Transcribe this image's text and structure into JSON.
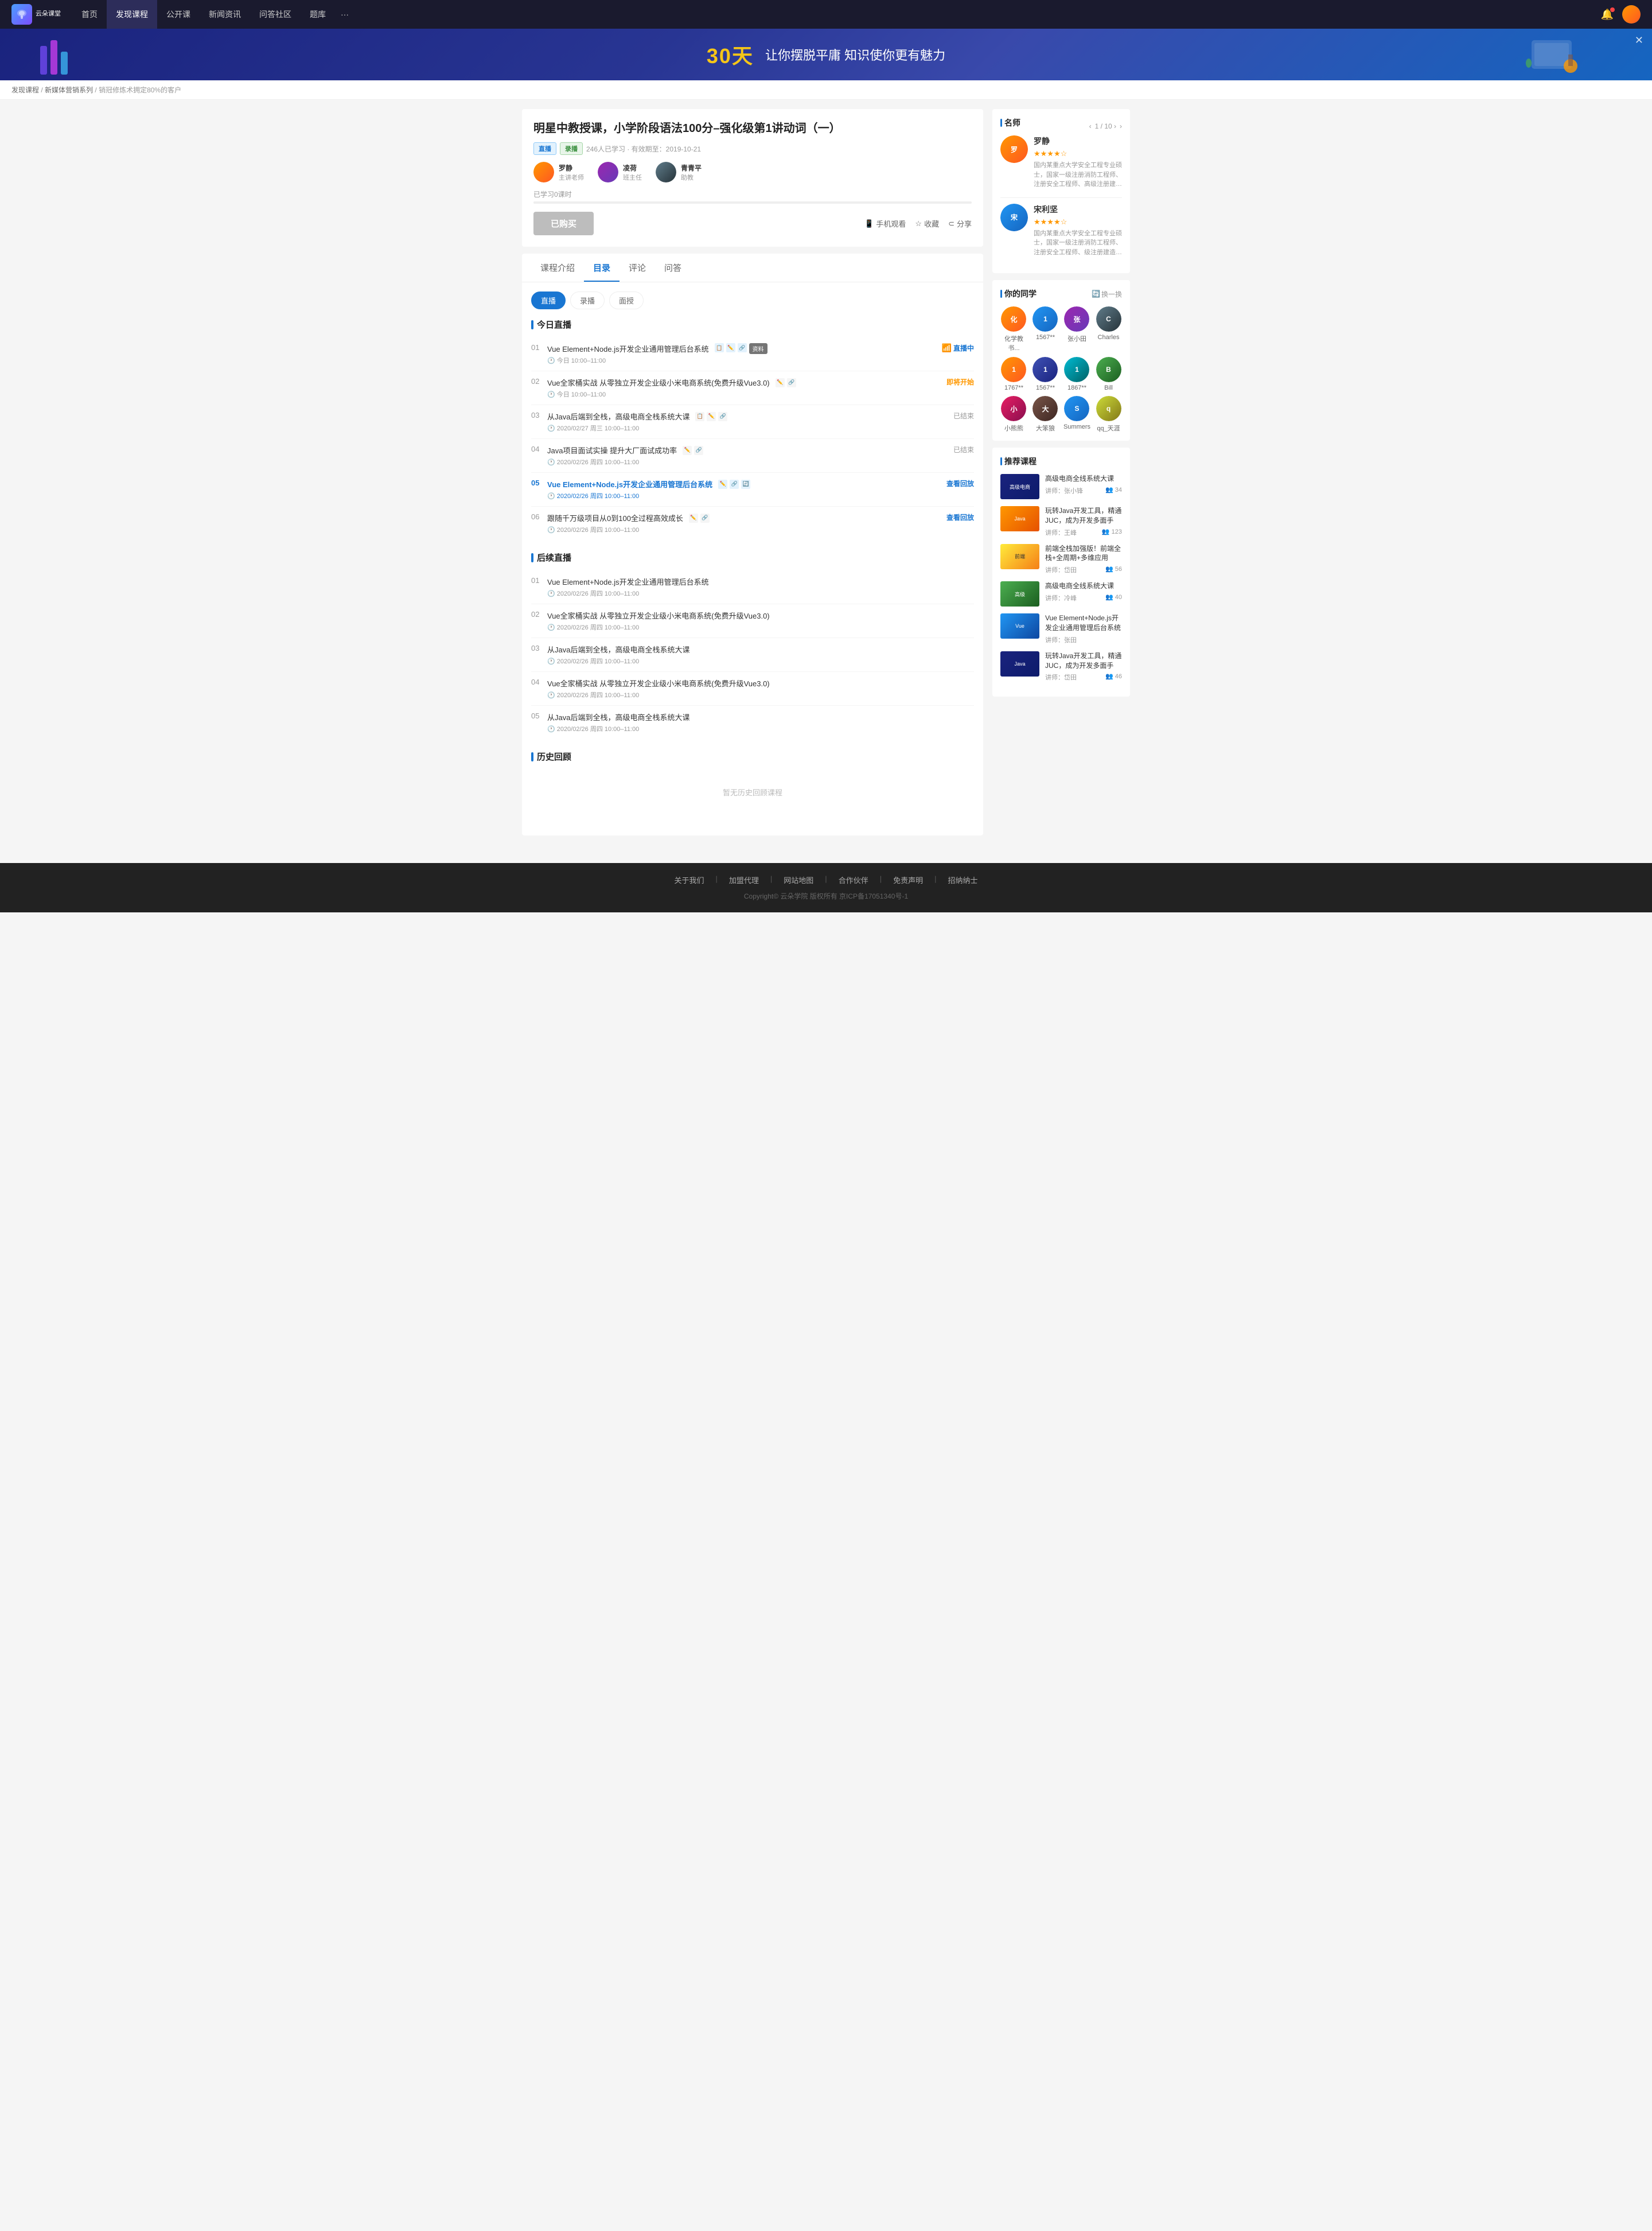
{
  "nav": {
    "logo_text": "云朵课堂",
    "items": [
      {
        "label": "首页",
        "active": false
      },
      {
        "label": "发现课程",
        "active": true
      },
      {
        "label": "公开课",
        "active": false
      },
      {
        "label": "新闻资讯",
        "active": false
      },
      {
        "label": "问答社区",
        "active": false
      },
      {
        "label": "题库",
        "active": false
      },
      {
        "label": "···",
        "active": false
      }
    ]
  },
  "banner": {
    "highlight": "30天",
    "text": "让你摆脱平庸 知识使你更有魅力",
    "close_label": "✕"
  },
  "breadcrumb": {
    "items": [
      "发现课程",
      "新媒体营销系列",
      "销冠修炼术拥定80%的客户"
    ]
  },
  "course": {
    "title": "明星中教授课，小学阶段语法100分–强化级第1讲动词（一）",
    "badges": [
      "直播",
      "录播"
    ],
    "meta": "246人已学习 · 有效期至：2019-10-21",
    "teachers": [
      {
        "name": "罗静",
        "role": "主讲老师"
      },
      {
        "name": "凌荷",
        "role": "班主任"
      },
      {
        "name": "青青平",
        "role": "助教"
      }
    ],
    "progress": "0%",
    "progress_label": "已学习0课时",
    "btn_bought": "已购买",
    "actions": [
      {
        "label": "手机观看",
        "icon": "📱"
      },
      {
        "label": "收藏",
        "icon": "☆"
      },
      {
        "label": "分享",
        "icon": "⊂"
      }
    ]
  },
  "tabs": {
    "items": [
      "课程介绍",
      "目录",
      "评论",
      "问答"
    ],
    "active": "目录"
  },
  "subtabs": {
    "items": [
      "直播",
      "录播",
      "面授"
    ],
    "active": "直播"
  },
  "today_live": {
    "title": "今日直播",
    "lessons": [
      {
        "num": "01",
        "title": "Vue Element+Node.js开发企业通用管理后台系统",
        "icons": [
          "📋",
          "✏️",
          "🔗"
        ],
        "has_material": true,
        "material_label": "资料",
        "time": "今日 10:00–11:00",
        "status": "直播中",
        "status_type": "live"
      },
      {
        "num": "02",
        "title": "Vue全家桶实战 从零独立开发企业级小米电商系统(免费升级Vue3.0)",
        "icons": [
          "✏️",
          "🔗"
        ],
        "time": "今日 10:00–11:00",
        "status": "即将开始",
        "status_type": "soon"
      },
      {
        "num": "03",
        "title": "从Java后端到全栈，高级电商全栈系统大课",
        "icons": [
          "📋",
          "✏️",
          "🔗"
        ],
        "time": "2020/02/27 周三 10:00–11:00",
        "status": "已结束",
        "status_type": "ended"
      },
      {
        "num": "04",
        "title": "Java项目面试实操 提升大厂面试成功率",
        "icons": [
          "✏️",
          "🔗"
        ],
        "time": "2020/02/26 周四 10:00–11:00",
        "status": "已结束",
        "status_type": "ended"
      },
      {
        "num": "05",
        "title": "Vue Element+Node.js开发企业通用管理后台系统",
        "icons": [
          "✏️",
          "🔗",
          "🔄"
        ],
        "time": "2020/02/26 周四 10:00–11:00",
        "status": "查看回放",
        "status_type": "replay",
        "active": true
      },
      {
        "num": "06",
        "title": "跟随千万级项目从0到100全过程高效成长",
        "icons": [
          "✏️",
          "🔗"
        ],
        "time": "2020/02/26 周四 10:00–11:00",
        "status": "查看回放",
        "status_type": "replay"
      }
    ]
  },
  "future_live": {
    "title": "后续直播",
    "lessons": [
      {
        "num": "01",
        "title": "Vue Element+Node.js开发企业通用管理后台系统",
        "time": "2020/02/26 周四 10:00–11:00"
      },
      {
        "num": "02",
        "title": "Vue全家桶实战 从零独立开发企业级小米电商系统(免费升级Vue3.0)",
        "time": "2020/02/26 周四 10:00–11:00"
      },
      {
        "num": "03",
        "title": "从Java后端到全栈，高级电商全栈系统大课",
        "time": "2020/02/26 周四 10:00–11:00"
      },
      {
        "num": "04",
        "title": "Vue全家桶实战 从零独立开发企业级小米电商系统(免费升级Vue3.0)",
        "time": "2020/02/26 周四 10:00–11:00"
      },
      {
        "num": "05",
        "title": "从Java后端到全栈，高级电商全栈系统大课",
        "time": "2020/02/26 周四 10:00–11:00"
      }
    ]
  },
  "history": {
    "title": "历史回顾",
    "empty_label": "暂无历史回顾课程"
  },
  "sidebar": {
    "teachers": {
      "title": "名师",
      "nav": "1 / 10 ›",
      "items": [
        {
          "name": "罗静",
          "stars": 4,
          "desc": "国内某重点大学安全工程专业硕士，国家一级注册消防工程师、注册安全工程师、高级注册建造师，深海教育独家签..."
        },
        {
          "name": "宋利坚",
          "stars": 4,
          "desc": "国内某重点大学安全工程专业硕士，国家一级注册消防工程师、注册安全工程师、级注册建造师，独家签约讲师，累计授..."
        }
      ]
    },
    "classmates": {
      "title": "你的同学",
      "refresh": "换一换",
      "items": [
        {
          "name": "化学教书...",
          "color": "av-orange"
        },
        {
          "name": "1567**",
          "color": "av-blue"
        },
        {
          "name": "张小田",
          "color": "av-purple"
        },
        {
          "name": "Charles",
          "color": "av-gray"
        },
        {
          "name": "1767**",
          "color": "av-orange"
        },
        {
          "name": "1567**",
          "color": "av-indigo"
        },
        {
          "name": "1867**",
          "color": "av-teal"
        },
        {
          "name": "Bill",
          "color": "av-green"
        },
        {
          "name": "小熊熊",
          "color": "av-pink"
        },
        {
          "name": "大笨狼",
          "color": "av-brown"
        },
        {
          "name": "Summers",
          "color": "av-blue"
        },
        {
          "name": "qq_天涯",
          "color": "av-lime"
        }
      ]
    },
    "recommend": {
      "title": "推荐课程",
      "items": [
        {
          "thumb_color": "thumb-navy",
          "title": "高级电商全线系统大课",
          "teacher": "张小锋",
          "students": "34"
        },
        {
          "thumb_color": "thumb-orange",
          "title": "玩转Java开发工具，精通JUC，成为开发多面手",
          "teacher": "王峰",
          "students": "123"
        },
        {
          "thumb_color": "thumb-yellow",
          "title": "前端全栈加强版！前端全栈+全周期+多维应用",
          "teacher": "岱田",
          "students": "56"
        },
        {
          "thumb_color": "thumb-green",
          "title": "高级电商全线系统大课",
          "teacher": "冷峰",
          "students": "40"
        },
        {
          "thumb_color": "thumb-blue",
          "title": "Vue Element+Node.js开发企业通用管理后台系统",
          "teacher": "张田",
          "students": ""
        },
        {
          "thumb_color": "thumb-navy",
          "title": "玩转Java开发工具，精通JUC，成为开发多面手",
          "teacher": "岱田",
          "students": "46"
        }
      ]
    }
  },
  "footer": {
    "links": [
      "关于我们",
      "加盟代理",
      "网站地图",
      "合作伙伴",
      "免责声明",
      "招纳纳士"
    ],
    "copyright": "Copyright© 云朵学院  版权所有  京ICP备17051340号-1"
  }
}
